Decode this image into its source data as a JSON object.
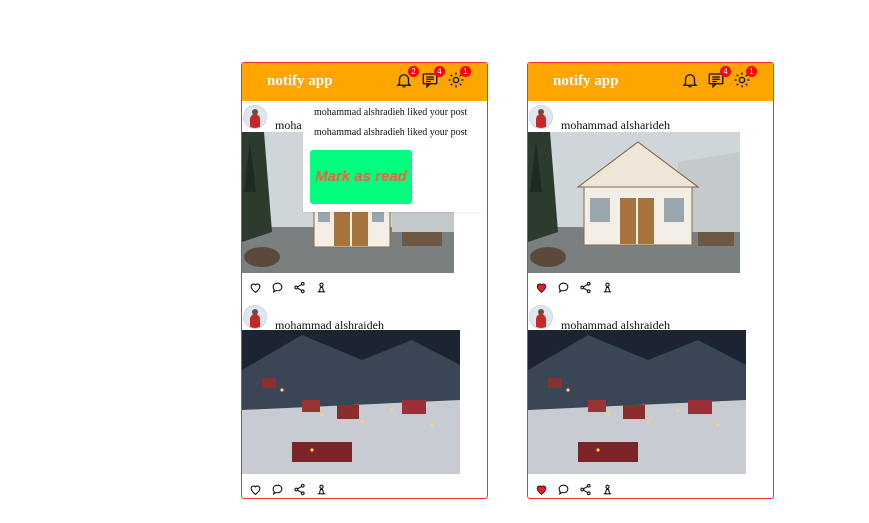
{
  "apps": [
    {
      "title": "notify app",
      "badges": {
        "notifications": "2",
        "messages": "4",
        "settings": "1"
      },
      "dropdown": {
        "items": [
          "mohammad alshradieh liked your post",
          "mohammad alshradieh liked your post"
        ],
        "mark_read_label": "Mark as read"
      },
      "posts": [
        {
          "user": "moha",
          "liked": false
        },
        {
          "user": "mohammad alshraideh",
          "liked": false
        }
      ]
    },
    {
      "title": "notify app",
      "badges": {
        "notifications": "",
        "messages": "4",
        "settings": "1"
      },
      "posts": [
        {
          "user": "mohammad alsharideh",
          "liked": true
        },
        {
          "user": "mohammad alshraideh",
          "liked": true
        }
      ]
    }
  ],
  "colors": {
    "header": "#ffa500",
    "badge": "#ff0000",
    "border": "#ee3333",
    "mark_button": "#00ff7f",
    "mark_text": "#ff5a3c",
    "liked_heart": "#e0202a"
  },
  "icons": [
    "bell-icon",
    "message-icon",
    "settings-icon",
    "heart-icon",
    "comment-icon",
    "share-icon",
    "info-icon"
  ]
}
